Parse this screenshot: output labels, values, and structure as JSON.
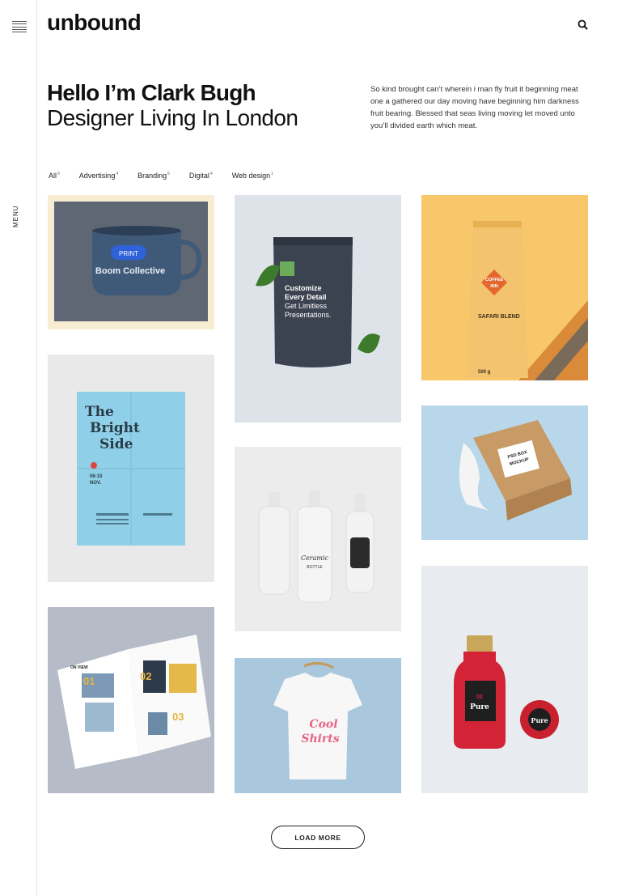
{
  "brand": {
    "logo": "unbound"
  },
  "sidebar": {
    "menu_label": "MENU"
  },
  "hero": {
    "title": "Hello I’m Clark Bugh",
    "subtitle": "Designer Living In London",
    "description": "So kind brought can’t wherein i man fly fruit it beginning meat one a gathered our day moving have beginning him darkness fruit bearing. Blessed that seas living moving let moved unto you’ll divided earth which meat."
  },
  "filters": [
    {
      "label": "All",
      "count": "9"
    },
    {
      "label": "Advertising",
      "count": "4"
    },
    {
      "label": "Branding",
      "count": "6"
    },
    {
      "label": "Digital",
      "count": "4"
    },
    {
      "label": "Web design",
      "count": "1"
    }
  ],
  "portfolio": {
    "mug": {
      "badge": "PRINT",
      "caption": "Boom Collective"
    },
    "pouch": {
      "line1": "Customize",
      "line2": "Every Detail",
      "line3": "Get Limitless",
      "line4": "Presentations."
    },
    "coffee": {
      "brand1": "COFFEE",
      "brand2": "INN",
      "product": "SAFARI BLEND",
      "weight": "500 g"
    },
    "poster": {
      "line1": "The",
      "line2": "Bright",
      "line3": "Side",
      "date1": "06-10",
      "date2": "NOV."
    },
    "box": {
      "line1": "PSD BOX",
      "line2": "MOCKUP"
    },
    "bottles": {
      "label1": "Ceramic",
      "label2": "BOTTLE"
    },
    "magazine": {
      "header": "ON VIEW",
      "n1": "01",
      "n2": "02",
      "n3": "03"
    },
    "tshirt": {
      "line1": "Cool",
      "line2": "Shirts"
    },
    "jar": {
      "label": "Pure",
      "number": "02"
    }
  },
  "load_more": "LOAD MORE",
  "colors": {
    "accent_blue": "#2f62d8",
    "text": "#111111",
    "yellow_bg": "#f7c76a",
    "light_blue_bg": "#a9c7dd"
  }
}
